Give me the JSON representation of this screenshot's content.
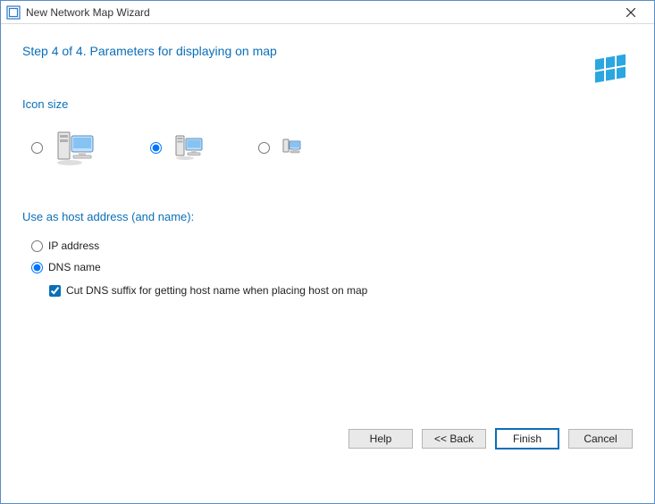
{
  "window": {
    "title": "New Network Map Wizard"
  },
  "heading": "Step 4 of 4. Parameters for displaying on map",
  "sections": {
    "icon_size": "Icon size",
    "host_address": "Use as host address (and name):"
  },
  "icon_size": {
    "selected_index": 1
  },
  "host_address": {
    "ip_label": "IP address",
    "dns_label": "DNS name",
    "selected": "dns",
    "cut_suffix_label": "Cut DNS suffix for getting host name when placing host on map",
    "cut_suffix_checked": true
  },
  "buttons": {
    "help": "Help",
    "back": "<< Back",
    "finish": "Finish",
    "cancel": "Cancel"
  },
  "colors": {
    "accent": "#0a6fb8",
    "decor": "#2aa6e0"
  }
}
